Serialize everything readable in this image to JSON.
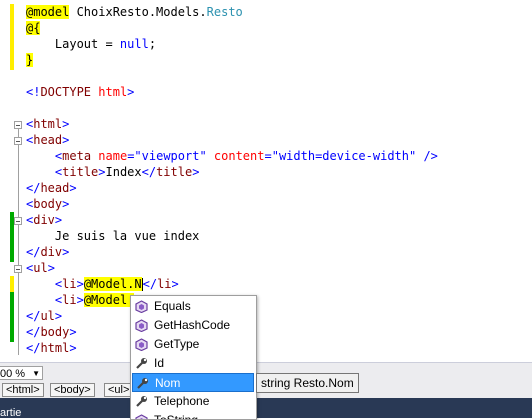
{
  "code": {
    "l1_kw": "@model",
    "l1_mid": " ChoixResto.Models.",
    "l1_type": "Resto",
    "l2": "@{",
    "l3_pre": "    Layout = ",
    "l3_kw": "null",
    "l3_post": ";",
    "l4": "}",
    "l6": "<!DOCTYPE html>",
    "html_tag": "html",
    "head_tag": "head",
    "meta_tag": "meta",
    "meta_name_attr": "name",
    "meta_name_val": "\"viewport\"",
    "meta_content_attr": "content",
    "meta_content_val": "\"width=device-width\"",
    "title_tag": "title",
    "title_text": "Index",
    "body_tag": "body",
    "div_tag": "div",
    "div_text": "Je suis la vue index",
    "ul_tag": "ul",
    "li_tag": "li",
    "li1_text": "@Model.N",
    "li2_text": "@Model."
  },
  "status": {
    "zoom": "00 %",
    "breadcrumbs": [
      "<html>",
      "<body>",
      "<ul>"
    ]
  },
  "bottom_bar_text": "artie",
  "intellisense": {
    "items": [
      {
        "label": "Equals",
        "icon": "method-icon"
      },
      {
        "label": "GetHashCode",
        "icon": "method-icon"
      },
      {
        "label": "GetType",
        "icon": "method-icon"
      },
      {
        "label": "Id",
        "icon": "property-wrench-icon"
      },
      {
        "label": "Nom",
        "icon": "property-wrench-icon"
      },
      {
        "label": "Telephone",
        "icon": "property-wrench-icon"
      },
      {
        "label": "ToString",
        "icon": "method-icon"
      }
    ],
    "selected": "Nom",
    "tooltip": "string Resto.Nom"
  },
  "colors": {
    "tag": "#800000",
    "bracket": "#0000ff",
    "attribute": "#ff0000",
    "keyword": "#0000ff",
    "type": "#2b91af",
    "razor_highlight": "#ffff00",
    "selection": "#3399ff",
    "changed_bar": "#00aa00",
    "unsaved_bar": "#ffee00"
  }
}
